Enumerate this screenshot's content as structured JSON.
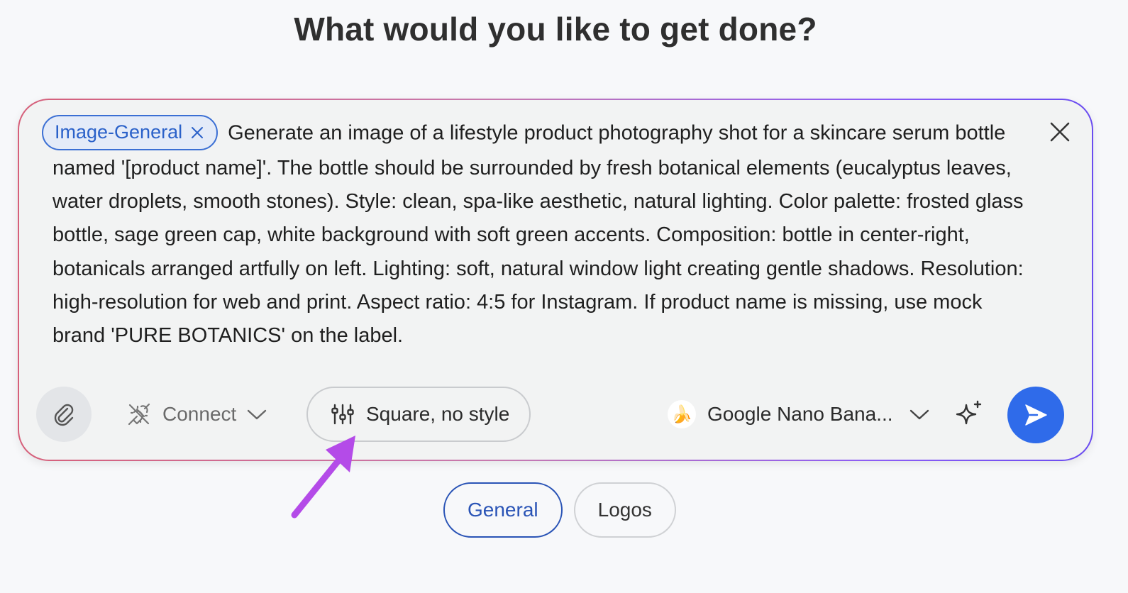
{
  "page": {
    "heading": "What would you like to get done?"
  },
  "composer": {
    "tag_chip_label": "Image-General",
    "prompt_text": "Generate an image of a lifestyle product photography shot for a skincare serum bottle named '[product name]'. The bottle should be surrounded by fresh botanical elements (eucalyptus leaves, water droplets, smooth stones). Style: clean, spa-like aesthetic, natural lighting. Color palette: frosted glass bottle, sage green cap, white background with soft green accents. Composition: bottle in center-right, botanicals arranged artfully on left. Lighting: soft, natural window light creating gentle shadows. Resolution: high-resolution for web and print. Aspect ratio: 4:5 for Instagram. If product name is missing, use mock brand 'PURE BOTANICS' on the label.",
    "close_icon": "close-icon"
  },
  "toolbar": {
    "attach_icon": "paperclip-icon",
    "connect_label": "Connect",
    "aspect_style_label": "Square, no style",
    "model_emoji": "🍌",
    "model_label": "Google Nano Bana...",
    "enhance_icon": "sparkle-icon",
    "send_icon": "send-icon"
  },
  "categories": [
    {
      "label": "General",
      "active": true
    },
    {
      "label": "Logos",
      "active": false
    }
  ],
  "colors": {
    "accent_blue": "#2f6bea",
    "chip_blue": "#2a61c9",
    "annotation_arrow": "#b44be8",
    "border_gradient_start": "#d6607a",
    "border_gradient_end": "#6a4cf0"
  }
}
